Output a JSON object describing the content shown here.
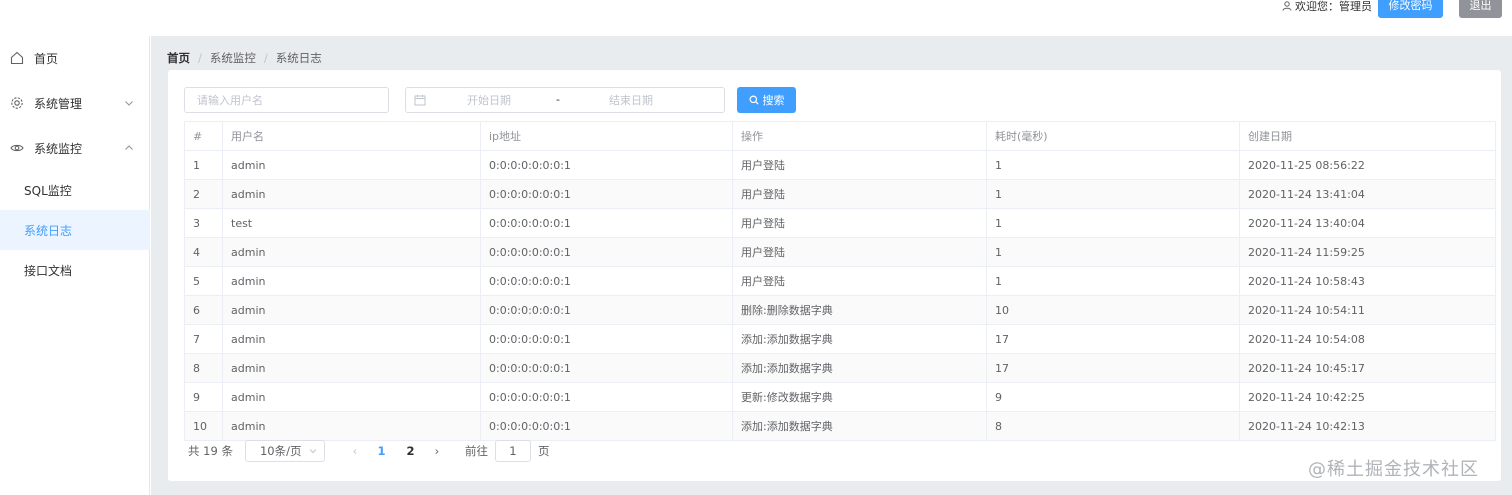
{
  "header": {
    "welcome": "欢迎您：管理员",
    "change_password": "修改密码",
    "logout": "退出"
  },
  "sidebar": {
    "items": [
      {
        "label": "首页",
        "icon": "home-icon"
      },
      {
        "label": "系统管理",
        "icon": "gear-icon"
      },
      {
        "label": "系统监控",
        "icon": "eye-icon"
      }
    ],
    "sub_items": [
      {
        "label": "SQL监控"
      },
      {
        "label": "系统日志"
      },
      {
        "label": "接口文档"
      }
    ]
  },
  "breadcrumb": {
    "home": "首页",
    "level2": "系统监控",
    "level3": "系统日志",
    "separator": "/"
  },
  "search": {
    "username_placeholder": "请输入用户名",
    "start_placeholder": "开始日期",
    "range_separator": "-",
    "end_placeholder": "结束日期",
    "button": "搜索"
  },
  "table": {
    "columns": [
      "#",
      "用户名",
      "ip地址",
      "操作",
      "耗时(毫秒)",
      "创建日期"
    ],
    "rows": [
      [
        "1",
        "admin",
        "0:0:0:0:0:0:0:1",
        "用户登陆",
        "1",
        "2020-11-25 08:56:22"
      ],
      [
        "2",
        "admin",
        "0:0:0:0:0:0:0:1",
        "用户登陆",
        "1",
        "2020-11-24 13:41:04"
      ],
      [
        "3",
        "test",
        "0:0:0:0:0:0:0:1",
        "用户登陆",
        "1",
        "2020-11-24 13:40:04"
      ],
      [
        "4",
        "admin",
        "0:0:0:0:0:0:0:1",
        "用户登陆",
        "1",
        "2020-11-24 11:59:25"
      ],
      [
        "5",
        "admin",
        "0:0:0:0:0:0:0:1",
        "用户登陆",
        "1",
        "2020-11-24 10:58:43"
      ],
      [
        "6",
        "admin",
        "0:0:0:0:0:0:0:1",
        "删除:删除数据字典",
        "10",
        "2020-11-24 10:54:11"
      ],
      [
        "7",
        "admin",
        "0:0:0:0:0:0:0:1",
        "添加:添加数据字典",
        "17",
        "2020-11-24 10:54:08"
      ],
      [
        "8",
        "admin",
        "0:0:0:0:0:0:0:1",
        "添加:添加数据字典",
        "17",
        "2020-11-24 10:45:17"
      ],
      [
        "9",
        "admin",
        "0:0:0:0:0:0:0:1",
        "更新:修改数据字典",
        "9",
        "2020-11-24 10:42:25"
      ],
      [
        "10",
        "admin",
        "0:0:0:0:0:0:0:1",
        "添加:添加数据字典",
        "8",
        "2020-11-24 10:42:13"
      ]
    ]
  },
  "pagination": {
    "total": "共 19 条",
    "page_size": "10条/页",
    "prev": "‹",
    "next": "›",
    "pages": [
      "1",
      "2"
    ],
    "current_page": "1",
    "goto_prefix": "前往",
    "goto_value": "1",
    "goto_suffix": "页"
  },
  "watermark": "@稀土掘金技术社区",
  "colors": {
    "primary": "#409eff",
    "info": "#909399",
    "active_bg": "#ecf5ff"
  }
}
